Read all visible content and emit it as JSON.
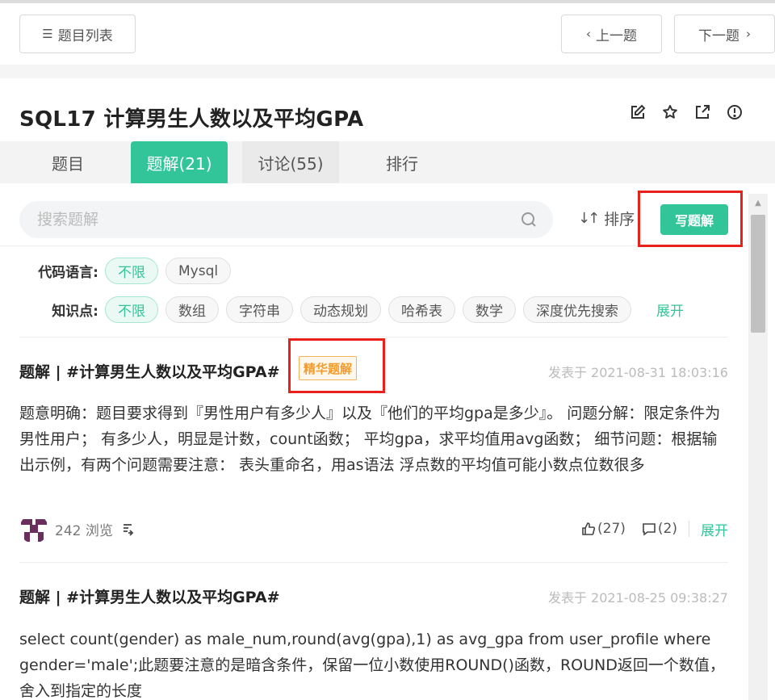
{
  "topbar": {
    "list_label": "题目列表",
    "prev_label": "上一题",
    "next_label": "下一题"
  },
  "problem": {
    "title": "SQL17  计算男生人数以及平均GPA"
  },
  "tabs": [
    {
      "label": "题目"
    },
    {
      "label": "题解(21)"
    },
    {
      "label": "讨论(55)"
    },
    {
      "label": "排行"
    }
  ],
  "search": {
    "placeholder": "搜索题解",
    "sort_label": "排序",
    "write_label": "写题解"
  },
  "filters": {
    "lang_label": "代码语言:",
    "lang_options": [
      "不限",
      "Mysql"
    ],
    "knowledge_label": "知识点:",
    "knowledge_options": [
      "不限",
      "数组",
      "字符串",
      "动态规划",
      "哈希表",
      "数学",
      "深度优先搜索"
    ],
    "expand_label": "展开"
  },
  "posts": [
    {
      "title": "题解 | #计算男生人数以及平均GPA#",
      "badge": "精华题解",
      "date": "发表于 2021-08-31 18:03:16",
      "body": "题意明确：题目要求得到『男性用户有多少人』以及『他们的平均gpa是多少』。 问题分解：限定条件为 男性用户；  有多少人，明显是计数，count函数；  平均gpa，求平均值用avg函数； 细节问题：根据输出示例，有两个问题需要注意：  表头重命名，用as语法 浮点数的平均值可能小数点位数很多",
      "views": "242 浏览",
      "likes": "(27)",
      "comments": "(2)",
      "expand": "展开"
    },
    {
      "title": "题解 | #计算男生人数以及平均GPA#",
      "date": "发表于 2021-08-25 09:38:27",
      "body": "select count(gender) as male_num,round(avg(gpa),1) as avg_gpa from user_profile where gender='male';此题要注意的是暗含条件，保留一位小数使用ROUND()函数，ROUND返回一个数值，舍入到指定的长度"
    }
  ],
  "colors": {
    "accent": "#32c59a",
    "highlight_red": "#e8221b",
    "badge_orange": "#f39c2b"
  }
}
